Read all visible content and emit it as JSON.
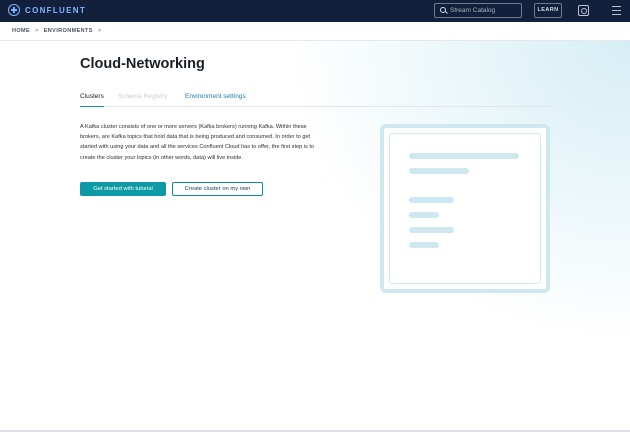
{
  "header": {
    "logo_text": "CONFLUENT",
    "search_placeholder": "Stream Catalog",
    "learn_label": "LEARN",
    "icons": [
      "confluent-logo-icon",
      "search-icon",
      "help-icon",
      "menu-icon"
    ]
  },
  "breadcrumb": {
    "items": [
      "HOME",
      "ENVIRONMENTS"
    ],
    "separator": ">"
  },
  "page": {
    "title": "Cloud-Networking",
    "tabs": [
      {
        "label": "Clusters",
        "state": "active"
      },
      {
        "label": "Schema Registry",
        "state": "disabled"
      },
      {
        "label": "Environment settings",
        "state": "normal"
      }
    ],
    "description": "A Kafka cluster consists of one or more servers (Kafka brokers) running Kafka. Within these brokers, are Kafka topics that hold data that is being produced and consumed. In order to get started with using your data and all the services Confluent Cloud has to offer, the first step is to create the cluster your topics (in other words, data) will live inside.",
    "primary_button": "Get started with tutorial",
    "secondary_button": "Create cluster on my own"
  },
  "colors": {
    "topbar": "#12203b",
    "accent": "#0d9aa5",
    "link": "#1a7cb0",
    "illustration": "#cfe8f0"
  }
}
